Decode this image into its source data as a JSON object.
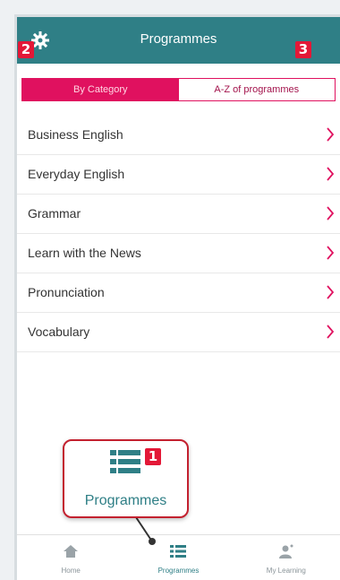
{
  "header": {
    "title": "Programmes",
    "settings_icon": "gear-icon"
  },
  "tabs": [
    {
      "label": "By Category",
      "active": true
    },
    {
      "label": "A-Z of programmes",
      "active": false
    }
  ],
  "categories": [
    "Business English",
    "Everyday English",
    "Grammar",
    "Learn with the News",
    "Pronunciation",
    "Vocabulary"
  ],
  "callout": {
    "label": "Programmes",
    "icon": "list-icon"
  },
  "badges": {
    "b1": "1",
    "b2": "2",
    "b3": "3"
  },
  "tabbar": [
    {
      "label": "Home",
      "icon": "home-icon",
      "active": false
    },
    {
      "label": "Programmes",
      "icon": "list-icon",
      "active": true
    },
    {
      "label": "My Learning",
      "icon": "my-learning-icon",
      "active": false
    }
  ],
  "colors": {
    "header": "#2f7f86",
    "tab_accent": "#e0115f",
    "badge": "#e31837",
    "callout_border": "#c3212f"
  }
}
